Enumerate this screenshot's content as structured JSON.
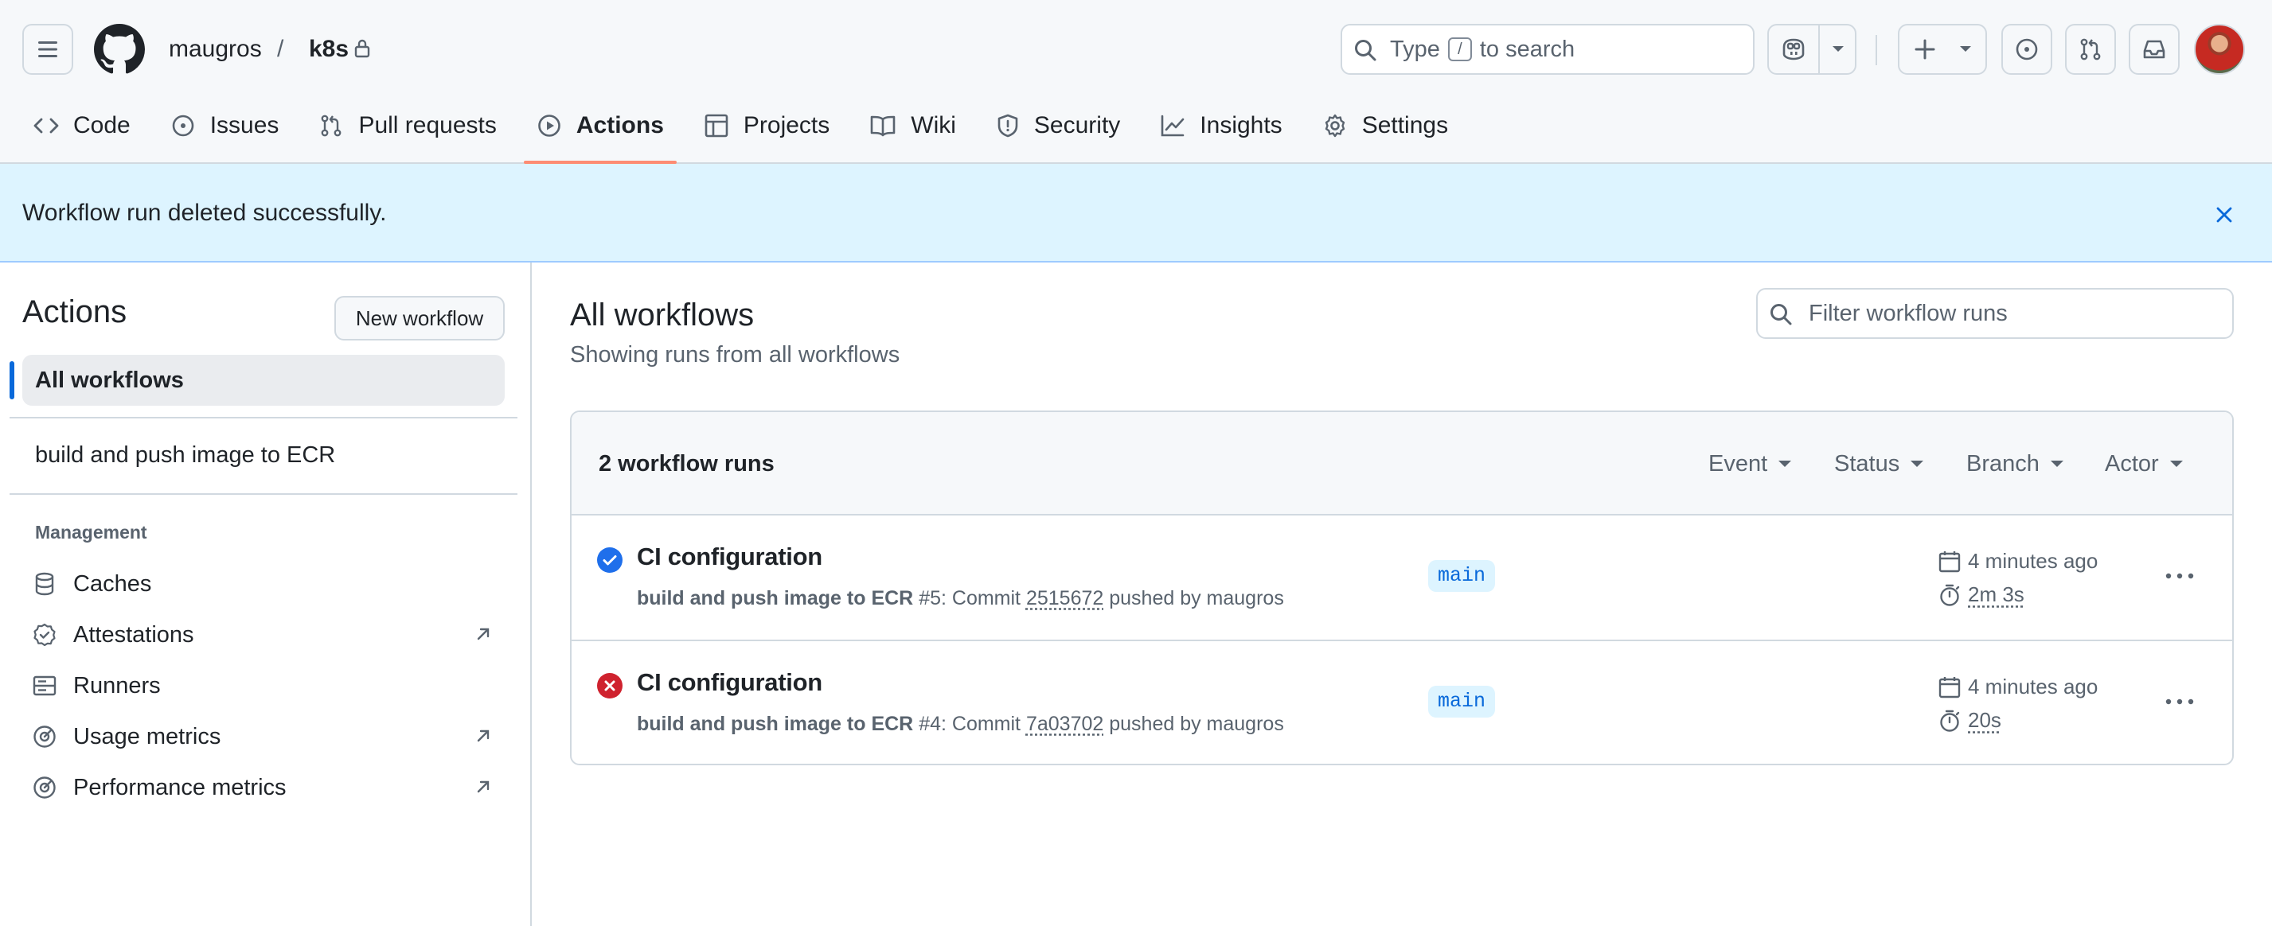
{
  "header": {
    "owner": "maugros",
    "separator": "/",
    "repo": "k8s",
    "search_prefix": "Type",
    "search_key": "/",
    "search_suffix": "to search"
  },
  "tabs": [
    {
      "label": "Code",
      "icon": "code-icon"
    },
    {
      "label": "Issues",
      "icon": "issue-opened-icon"
    },
    {
      "label": "Pull requests",
      "icon": "git-pull-request-icon"
    },
    {
      "label": "Actions",
      "icon": "play-icon"
    },
    {
      "label": "Projects",
      "icon": "table-icon"
    },
    {
      "label": "Wiki",
      "icon": "book-icon"
    },
    {
      "label": "Security",
      "icon": "shield-icon"
    },
    {
      "label": "Insights",
      "icon": "graph-icon"
    },
    {
      "label": "Settings",
      "icon": "gear-icon"
    }
  ],
  "flash": {
    "message": "Workflow run deleted successfully."
  },
  "sidebar": {
    "title": "Actions",
    "new_workflow": "New workflow",
    "all_workflows": "All workflows",
    "workflow": "build and push image to ECR",
    "management_heading": "Management",
    "items": [
      {
        "label": "Caches",
        "icon": "database-icon"
      },
      {
        "label": "Attestations",
        "icon": "verified-icon",
        "external": true
      },
      {
        "label": "Runners",
        "icon": "server-icon"
      },
      {
        "label": "Usage metrics",
        "icon": "meter-icon",
        "external": true
      },
      {
        "label": "Performance metrics",
        "icon": "meter-icon",
        "external": true
      }
    ]
  },
  "main": {
    "title": "All workflows",
    "subtitle": "Showing runs from all workflows",
    "filter_placeholder": "Filter workflow runs",
    "runs_count": "2 workflow runs",
    "filters": [
      "Event",
      "Status",
      "Branch",
      "Actor"
    ],
    "runs": [
      {
        "status": "success",
        "title": "CI configuration",
        "workflow": "build and push image to ECR",
        "number_text": "#5: Commit",
        "sha": "2515672",
        "pushed_by": "pushed by maugros",
        "branch": "main",
        "when": "4 minutes ago",
        "duration": "2m 3s"
      },
      {
        "status": "failure",
        "title": "CI configuration",
        "workflow": "build and push image to ECR",
        "number_text": "#4: Commit",
        "sha": "7a03702",
        "pushed_by": "pushed by maugros",
        "branch": "main",
        "when": "4 minutes ago",
        "duration": "20s"
      }
    ]
  },
  "colors": {
    "accent": "#0969da",
    "success": "#1f6feb",
    "failure": "#cf222e",
    "tab_underline": "#fd8c73",
    "flash_bg": "#ddf4ff"
  }
}
